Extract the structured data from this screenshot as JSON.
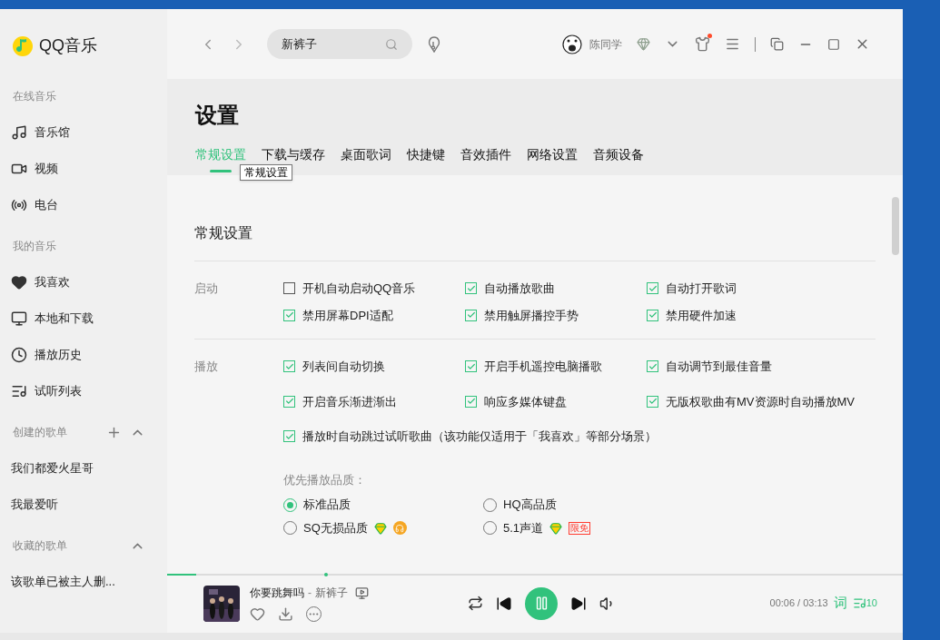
{
  "app": {
    "name": "QQ音乐"
  },
  "sidebar": {
    "sections": [
      {
        "title": "在线音乐",
        "items": [
          {
            "label": "音乐馆"
          },
          {
            "label": "视频"
          },
          {
            "label": "电台"
          }
        ]
      },
      {
        "title": "我的音乐",
        "items": [
          {
            "label": "我喜欢"
          },
          {
            "label": "本地和下载"
          },
          {
            "label": "播放历史"
          },
          {
            "label": "试听列表"
          }
        ]
      },
      {
        "title": "创建的歌单",
        "add": true,
        "expanded": true,
        "items": [
          {
            "label": "我们都爱火星哥"
          },
          {
            "label": "我最爱听"
          }
        ]
      },
      {
        "title": "收藏的歌单",
        "expanded": true,
        "items": [
          {
            "label": "该歌单已被主人删..."
          }
        ]
      }
    ]
  },
  "topbar": {
    "search": {
      "value": "新裤子"
    },
    "user": {
      "name": "陈同学"
    },
    "notification": true
  },
  "settings": {
    "title": "设置",
    "tabs": [
      {
        "label": "常规设置",
        "selected": true
      },
      {
        "label": "下载与缓存",
        "selected": false
      },
      {
        "label": "桌面歌词",
        "selected": false
      },
      {
        "label": "快捷键",
        "selected": false
      },
      {
        "label": "音效插件",
        "selected": false
      },
      {
        "label": "网络设置",
        "selected": false
      },
      {
        "label": "音频设备",
        "selected": false
      }
    ],
    "tooltip": "常规设置",
    "section_title": "常规设置",
    "groups": [
      {
        "label": "启动",
        "options": [
          {
            "label": "开机自动启动QQ音乐",
            "checked": false
          },
          {
            "label": "自动播放歌曲",
            "checked": true
          },
          {
            "label": "自动打开歌词",
            "checked": true
          },
          {
            "label": "禁用屏幕DPI适配",
            "checked": true
          },
          {
            "label": "禁用触屏播控手势",
            "checked": true
          },
          {
            "label": "禁用硬件加速",
            "checked": true
          }
        ]
      },
      {
        "label": "播放",
        "options": [
          {
            "label": "列表间自动切换",
            "checked": true
          },
          {
            "label": "开启手机遥控电脑播歌",
            "checked": true
          },
          {
            "label": "自动调节到最佳音量",
            "checked": true
          },
          {
            "label": "开启音乐渐进渐出",
            "checked": true
          },
          {
            "label": "响应多媒体键盘",
            "checked": true
          },
          {
            "label": "无版权歌曲有MV资源时自动播放MV",
            "checked": true
          },
          {
            "label": "播放时自动跳过试听歌曲（该功能仅适用于「我喜欢」等部分场景）",
            "checked": true
          }
        ]
      }
    ],
    "quality": {
      "title": "优先播放品质：",
      "options": [
        {
          "label": "标准品质",
          "selected": true
        },
        {
          "label": "HQ高品质",
          "selected": false
        },
        {
          "label": "SQ无损品质",
          "selected": false,
          "vip": true,
          "lossless": true
        },
        {
          "label": "5.1声道",
          "selected": false,
          "vip": true,
          "free_text": "限免"
        }
      ]
    }
  },
  "player": {
    "title": "你要跳舞吗",
    "artist": "新裤子",
    "separator": "-",
    "playing": true,
    "time": "00:06 / 03:13",
    "lyrics": "词",
    "count": "10",
    "level": 0.04
  }
}
